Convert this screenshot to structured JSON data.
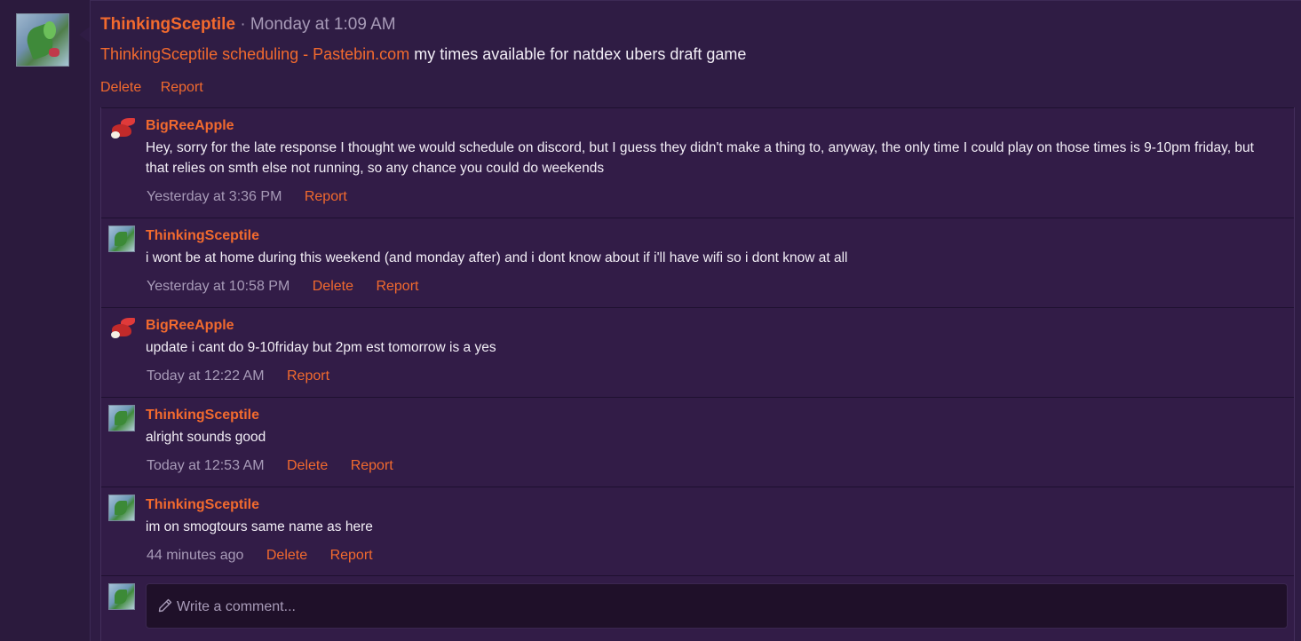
{
  "colors": {
    "accent": "#f26a2e",
    "background": "#2f1c44",
    "text": "#f2eef6",
    "muted": "#a89bb8"
  },
  "post": {
    "author": "ThinkingSceptile",
    "separator": "·",
    "time": "Monday at 1:09 AM",
    "link_text": "ThinkingSceptile scheduling - Pastebin.com",
    "body_text": "my times available for natdex ubers draft game",
    "actions": [
      "Delete",
      "Report"
    ]
  },
  "comments": [
    {
      "author": "BigReeApple",
      "text": "Hey, sorry for the late response I thought we would schedule on discord, but I guess they didn't make a thing to, anyway, the only time I could play on those times is 9-10pm friday, but that relies on smth else not running, so any chance you could do weekends",
      "time": "Yesterday at 3:36 PM",
      "actions": [
        "Report"
      ]
    },
    {
      "author": "ThinkingSceptile",
      "text": "i wont be at home during this weekend (and monday after) and i dont know about if i'll have wifi so i dont know at all",
      "time": "Yesterday at 10:58 PM",
      "actions": [
        "Delete",
        "Report"
      ]
    },
    {
      "author": "BigReeApple",
      "text": "update i cant do 9-10friday but 2pm est tomorrow is a yes",
      "time": "Today at 12:22 AM",
      "actions": [
        "Report"
      ]
    },
    {
      "author": "ThinkingSceptile",
      "text": "alright sounds good",
      "time": "Today at 12:53 AM",
      "actions": [
        "Delete",
        "Report"
      ]
    },
    {
      "author": "ThinkingSceptile",
      "text": "im on smogtours same name as here",
      "time": "44 minutes ago",
      "actions": [
        "Delete",
        "Report"
      ]
    }
  ],
  "reply": {
    "placeholder": "Write a comment..."
  }
}
